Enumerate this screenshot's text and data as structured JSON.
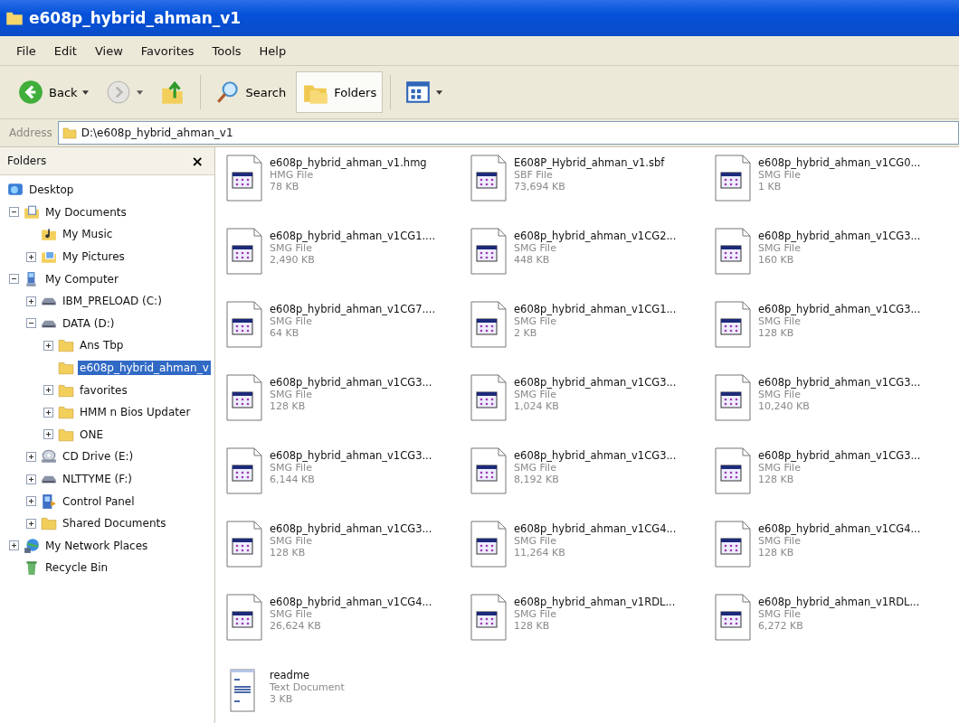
{
  "window": {
    "title": "e608p_hybrid_ahman_v1"
  },
  "menu": [
    "File",
    "Edit",
    "View",
    "Favorites",
    "Tools",
    "Help"
  ],
  "toolbar": [
    {
      "kind": "back",
      "label": "Back",
      "selected": false,
      "disabled": false
    },
    {
      "kind": "forward",
      "selected": false,
      "disabled": true
    },
    {
      "kind": "up",
      "selected": false,
      "disabled": false
    },
    {
      "kind": "search",
      "label": "Search",
      "selected": false,
      "disabled": false
    },
    {
      "kind": "folders",
      "label": "Folders",
      "selected": true,
      "disabled": false
    },
    {
      "kind": "views",
      "selected": false,
      "disabled": false
    }
  ],
  "address": {
    "label": "Address",
    "value": "D:\\e608p_hybrid_ahman_v1"
  },
  "folders_pane": {
    "title": "Folders",
    "close": "×"
  },
  "tree": {
    "items": [
      {
        "label": "Desktop",
        "kind": "desktop",
        "selected": false,
        "children": [
          {
            "label": "My Documents",
            "kind": "documents",
            "selected": false,
            "expanded": true,
            "children": [
              {
                "label": "My Music",
                "kind": "music",
                "selected": false
              },
              {
                "label": "My Pictures",
                "kind": "pictures",
                "selected": false,
                "expanded": false
              }
            ]
          },
          {
            "label": "My Computer",
            "kind": "computer",
            "selected": false,
            "expanded": true,
            "children": [
              {
                "label": "IBM_PRELOAD (C:)",
                "kind": "drive",
                "selected": false,
                "expanded": false
              },
              {
                "label": "DATA (D:)",
                "kind": "drive",
                "selected": false,
                "expanded": true,
                "children": [
                  {
                    "label": "Ans Tbp",
                    "kind": "folder",
                    "selected": false,
                    "expanded": false
                  },
                  {
                    "label": "e608p_hybrid_ahman_v",
                    "kind": "folder",
                    "selected": true
                  },
                  {
                    "label": "favorites",
                    "kind": "folder",
                    "selected": false,
                    "expanded": false
                  },
                  {
                    "label": "HMM n Bios Updater",
                    "kind": "folder",
                    "selected": false,
                    "expanded": false
                  },
                  {
                    "label": "ONE",
                    "kind": "folder",
                    "selected": false,
                    "expanded": false
                  }
                ]
              },
              {
                "label": "CD Drive (E:)",
                "kind": "cd",
                "selected": false,
                "expanded": false
              },
              {
                "label": "NLTTYME (F:)",
                "kind": "drive",
                "selected": false,
                "expanded": false
              },
              {
                "label": "Control Panel",
                "kind": "control",
                "selected": false,
                "expanded": false
              },
              {
                "label": "Shared Documents",
                "kind": "folder",
                "selected": false,
                "expanded": false
              }
            ]
          },
          {
            "label": "My Network Places",
            "kind": "network",
            "selected": false,
            "expanded": false
          },
          {
            "label": "Recycle Bin",
            "kind": "recycle",
            "selected": false
          }
        ]
      }
    ]
  },
  "files": [
    {
      "name": "e608p_hybrid_ahman_v1.hmg",
      "type": "HMG File",
      "size": "78 KB",
      "kind": "data"
    },
    {
      "name": "E608P_Hybrid_ahman_v1.sbf",
      "type": "SBF File",
      "size": "73,694 KB",
      "kind": "data"
    },
    {
      "name": "e608p_hybrid_ahman_v1CG0...",
      "type": "SMG File",
      "size": "1 KB",
      "kind": "data"
    },
    {
      "name": "e608p_hybrid_ahman_v1CG1....",
      "type": "SMG File",
      "size": "2,490 KB",
      "kind": "data"
    },
    {
      "name": "e608p_hybrid_ahman_v1CG2...",
      "type": "SMG File",
      "size": "448 KB",
      "kind": "data"
    },
    {
      "name": "e608p_hybrid_ahman_v1CG3...",
      "type": "SMG File",
      "size": "160 KB",
      "kind": "data"
    },
    {
      "name": "e608p_hybrid_ahman_v1CG7....",
      "type": "SMG File",
      "size": "64 KB",
      "kind": "data"
    },
    {
      "name": "e608p_hybrid_ahman_v1CG1...",
      "type": "SMG File",
      "size": "2 KB",
      "kind": "data"
    },
    {
      "name": "e608p_hybrid_ahman_v1CG3...",
      "type": "SMG File",
      "size": "128 KB",
      "kind": "data"
    },
    {
      "name": "e608p_hybrid_ahman_v1CG3...",
      "type": "SMG File",
      "size": "128 KB",
      "kind": "data"
    },
    {
      "name": "e608p_hybrid_ahman_v1CG3...",
      "type": "SMG File",
      "size": "1,024 KB",
      "kind": "data"
    },
    {
      "name": "e608p_hybrid_ahman_v1CG3...",
      "type": "SMG File",
      "size": "10,240 KB",
      "kind": "data"
    },
    {
      "name": "e608p_hybrid_ahman_v1CG3...",
      "type": "SMG File",
      "size": "6,144 KB",
      "kind": "data"
    },
    {
      "name": "e608p_hybrid_ahman_v1CG3...",
      "type": "SMG File",
      "size": "8,192 KB",
      "kind": "data"
    },
    {
      "name": "e608p_hybrid_ahman_v1CG3...",
      "type": "SMG File",
      "size": "128 KB",
      "kind": "data"
    },
    {
      "name": "e608p_hybrid_ahman_v1CG3...",
      "type": "SMG File",
      "size": "128 KB",
      "kind": "data"
    },
    {
      "name": "e608p_hybrid_ahman_v1CG4...",
      "type": "SMG File",
      "size": "11,264 KB",
      "kind": "data"
    },
    {
      "name": "e608p_hybrid_ahman_v1CG4...",
      "type": "SMG File",
      "size": "128 KB",
      "kind": "data"
    },
    {
      "name": "e608p_hybrid_ahman_v1CG4...",
      "type": "SMG File",
      "size": "26,624 KB",
      "kind": "data"
    },
    {
      "name": "e608p_hybrid_ahman_v1RDL...",
      "type": "SMG File",
      "size": "128 KB",
      "kind": "data"
    },
    {
      "name": "e608p_hybrid_ahman_v1RDL...",
      "type": "SMG File",
      "size": "6,272 KB",
      "kind": "data"
    },
    {
      "name": "readme",
      "type": "Text Document",
      "size": "3 KB",
      "kind": "text"
    }
  ]
}
